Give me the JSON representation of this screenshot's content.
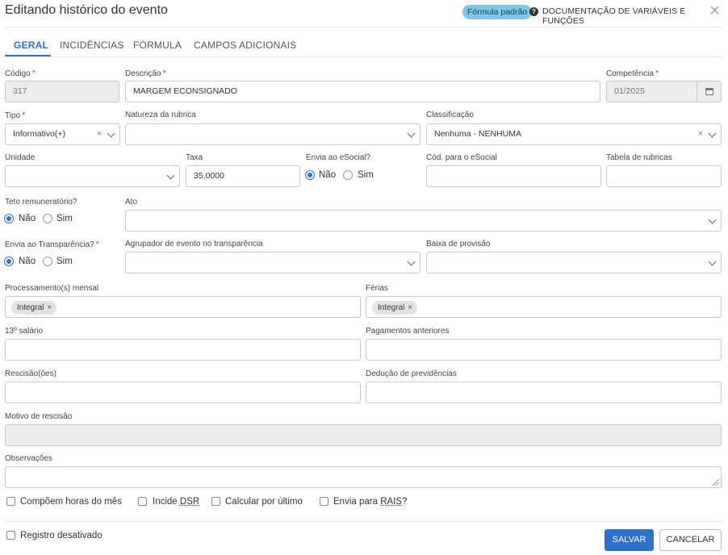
{
  "header": {
    "title": "Editando histórico do evento",
    "formula_badge": "Fórmula padrão",
    "doc_link": "DOCUMENTAÇÃO DE VARIÁVEIS E FUNÇÕES",
    "close": "✕",
    "help": "?"
  },
  "tabs": [
    "GERAL",
    "INCIDÊNCIAS",
    "FÓRMULA",
    "CAMPOS ADICIONAIS"
  ],
  "required_mark": "*",
  "fields": {
    "codigo": {
      "label": "Código",
      "value": "317"
    },
    "descricao": {
      "label": "Descrição",
      "value": "MARGEM ECONSIGNADO"
    },
    "competencia": {
      "label": "Competência",
      "value": "01/2025"
    },
    "tipo": {
      "label": "Tipo",
      "value": "Informativo(+)"
    },
    "natureza": {
      "label": "Natureza da rubrica",
      "value": ""
    },
    "classificacao": {
      "label": "Classificação",
      "value": "Nenhuma - NENHUMA"
    },
    "unidade": {
      "label": "Unidade",
      "value": ""
    },
    "taxa": {
      "label": "Taxa",
      "value": "35,0000"
    },
    "esocial": {
      "label": "Envia ao eSocial?",
      "options": [
        "Não",
        "Sim"
      ],
      "selected": "Não"
    },
    "cod_esocial": {
      "label": "Cód. para o eSocial",
      "value": ""
    },
    "tabela_rubricas": {
      "label": "Tabela de rubricas",
      "value": ""
    },
    "teto": {
      "label": "Teto remuneratório?",
      "options": [
        "Não",
        "Sim"
      ],
      "selected": "Não"
    },
    "ato": {
      "label": "Ato",
      "value": ""
    },
    "transparencia": {
      "label": "Envia ao Transparência?",
      "options": [
        "Não",
        "Sim"
      ],
      "selected": "Não"
    },
    "agrupador": {
      "label": "Agrupador de evento no transparência",
      "value": ""
    },
    "baixa": {
      "label": "Baixa de provisão",
      "value": ""
    },
    "processamento": {
      "label": "Processamento(s) mensal",
      "chips": [
        "Integral"
      ]
    },
    "ferias": {
      "label": "Férias",
      "chips": [
        "Integral"
      ]
    },
    "decimo": {
      "label": "13º salário",
      "value": ""
    },
    "pag_anteriores": {
      "label": "Pagamentos anteriores",
      "value": ""
    },
    "rescisao": {
      "label": "Rescisão(ões)",
      "value": ""
    },
    "deducao": {
      "label": "Dedução de previdências",
      "value": ""
    },
    "motivo": {
      "label": "Motivo de rescisão",
      "value": ""
    },
    "observacoes": {
      "label": "Observações",
      "value": ""
    }
  },
  "checkboxes": {
    "horas": "Compõem horas do mês",
    "incide_prefix": "Incide ",
    "incide_abbr": "DSR",
    "ultimo": "Calcular por último",
    "rais_prefix": "Envia para ",
    "rais_abbr": "RAIS",
    "rais_suffix": "?",
    "desativado": "Registro desativado"
  },
  "buttons": {
    "save": "SALVAR",
    "cancel": "CANCELAR"
  },
  "icons": {
    "clear": "×"
  },
  "colors": {
    "primary": "#2e6fc7",
    "required": "#e53935",
    "badge": "#7fc8e6"
  }
}
